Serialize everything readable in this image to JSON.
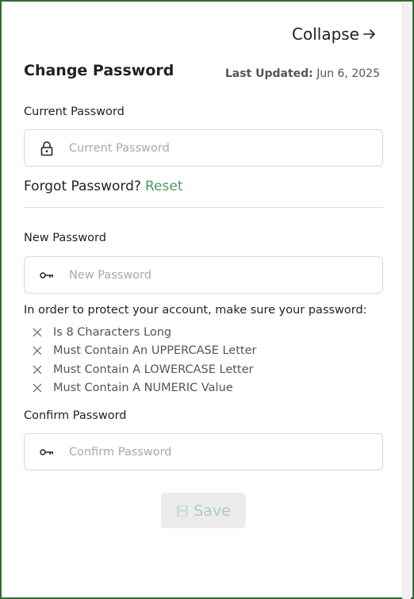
{
  "header": {
    "collapse_label": "Collapse",
    "title": "Change Password",
    "last_updated_label": "Last Updated:",
    "last_updated_value": "Jun 6, 2025"
  },
  "current_password": {
    "label": "Current Password",
    "placeholder": "Current Password",
    "icon": "lock-icon"
  },
  "forgot": {
    "text": "Forgot Password?",
    "reset_label": "Reset"
  },
  "new_password": {
    "label": "New Password",
    "placeholder": "New Password",
    "icon": "key-icon"
  },
  "requirements": {
    "heading": "In order to protect your account, make sure your password:",
    "items": [
      "Is 8 Characters Long",
      "Must Contain An UPPERCASE Letter",
      "Must Contain A LOWERCASE Letter",
      "Must Contain A NUMERIC Value"
    ]
  },
  "confirm_password": {
    "label": "Confirm Password",
    "placeholder": "Confirm Password",
    "icon": "key-icon"
  },
  "save": {
    "label": "Save",
    "icon": "floppy-disk-icon"
  },
  "colors": {
    "frame_border": "#2f6b34",
    "accent": "#4a9a5b",
    "save_text_disabled": "#a9cdb2"
  }
}
